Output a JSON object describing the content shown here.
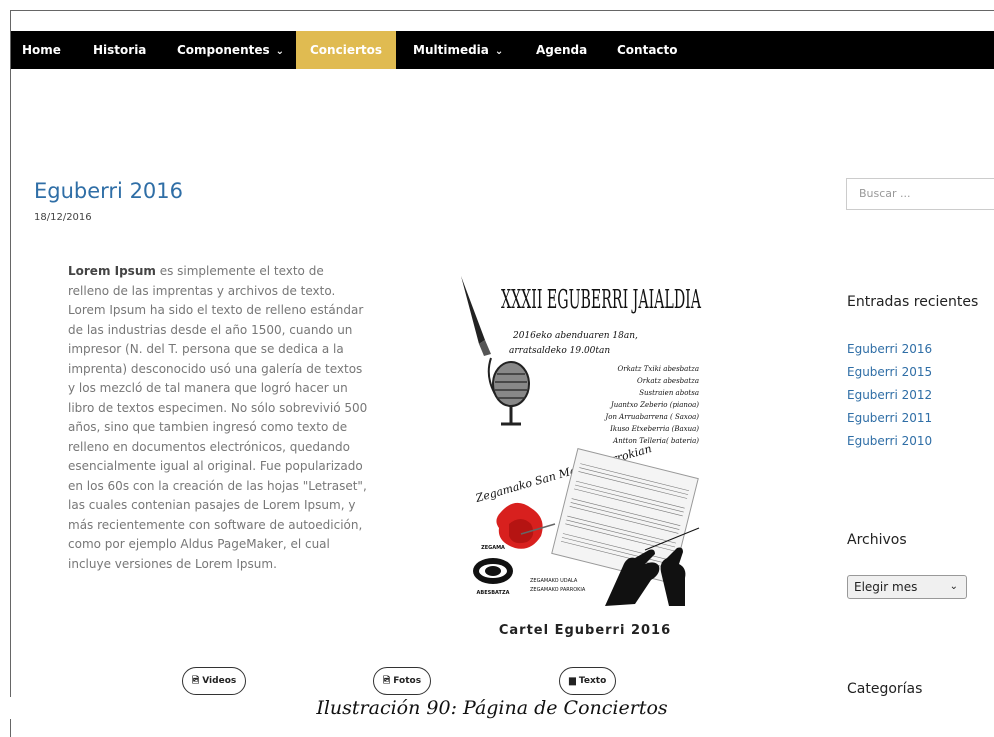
{
  "nav": {
    "items": [
      {
        "label": "Home"
      },
      {
        "label": "Historia"
      },
      {
        "label": "Componentes",
        "has_dropdown": true
      },
      {
        "label": "Conciertos",
        "active": true
      },
      {
        "label": "Multimedia",
        "has_dropdown": true
      },
      {
        "label": "Agenda"
      },
      {
        "label": "Contacto"
      }
    ],
    "active_color": "#e0bb51"
  },
  "post": {
    "title": "Eguberri 2016",
    "date": "18/12/2016",
    "body_bold": "Lorem Ipsum",
    "body_rest": " es simplemente el texto de relleno de las imprentas y archivos de texto. Lorem Ipsum ha sido el texto de relleno estándar de las industrias desde el año 1500, cuando un impresor (N. del T. persona que se dedica a la imprenta) desconocido usó una galería de textos y los mezcló de tal manera que logró hacer un libro de textos especimen. No sólo sobrevivió 500 años, sino que tambien ingresó como texto de relleno en documentos electrónicos, quedando esencialmente igual al original. Fue popularizado en los 60s con la creación de las hojas \"Letraset\", las cuales contenian pasajes de Lorem Ipsum, y más recientemente con software de autoedición, como por ejemplo Aldus PageMaker, el cual incluye versiones de Lorem Ipsum.",
    "image_caption": "Cartel Eguberri 2016"
  },
  "poster": {
    "headline": "XXXII EGUBERRI JAIALDIA",
    "date_line1": "2016eko abenduaren 18an,",
    "date_line2": "arratsaldeko 19.00tan",
    "performers": [
      "Orkatz Txiki abesbatza",
      "Orkatz abesbatza",
      "Sustraien abotsa",
      "Juantxo Zeberio (pianoa)",
      "Jon Arruabarrena ( Saxoa)",
      "Ikuso Etxeberria (Baxua)",
      "Antton Telleria( bateria)"
    ],
    "venue": "Zegamako San Martin parrokian",
    "logo_top": "ZEGAMA",
    "logo_bottom": "ABESBATZA",
    "sponsor1": "ZEGAMAKO UDALA",
    "sponsor2": "ZEGAMAKO PARROKIA"
  },
  "media_buttons": {
    "videos": "Videos",
    "fotos": "Fotos",
    "texto": "Texto"
  },
  "figure_caption": "Ilustración 90: Página de Conciertos",
  "sidebar": {
    "search_placeholder": "Buscar ...",
    "recent_title": "Entradas recientes",
    "recent_posts": [
      "Eguberri 2016",
      "Eguberri 2015",
      "Eguberri 2012",
      "Eguberri 2011",
      "Eguberri 2010"
    ],
    "archives_title": "Archivos",
    "archives_select": "Elegir mes",
    "categories_title": "Categorías"
  },
  "colors": {
    "link": "#2f6ea6",
    "nav_bg": "#000000"
  }
}
